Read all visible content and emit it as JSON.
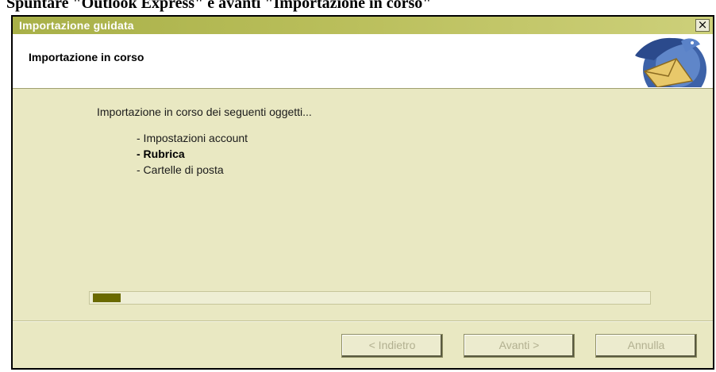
{
  "document": {
    "caption": "Spuntare \"Outlook Express\" e avanti \"Importazione in corso\""
  },
  "window": {
    "title": "Importazione guidata",
    "close_glyph": "×"
  },
  "header": {
    "title": "Importazione in corso",
    "logo_icon": "thunderbird-logo-icon"
  },
  "content": {
    "intro": "Importazione in corso dei seguenti oggetti...",
    "items": [
      {
        "label": "- Impostazioni account",
        "active": false
      },
      {
        "label": "- Rubrica",
        "active": true
      },
      {
        "label": "- Cartelle di posta",
        "active": false
      }
    ]
  },
  "progress": {
    "fraction": 0.05
  },
  "buttons": {
    "back_label": "< Indietro",
    "next_label": "Avanti >",
    "cancel_label": "Annulla",
    "enabled": false
  },
  "colors": {
    "titlebar": "#a8b048",
    "dialog_bg": "#e9e8c2",
    "progress_fill": "#6a6a00",
    "disabled_text": "#b2b090"
  }
}
